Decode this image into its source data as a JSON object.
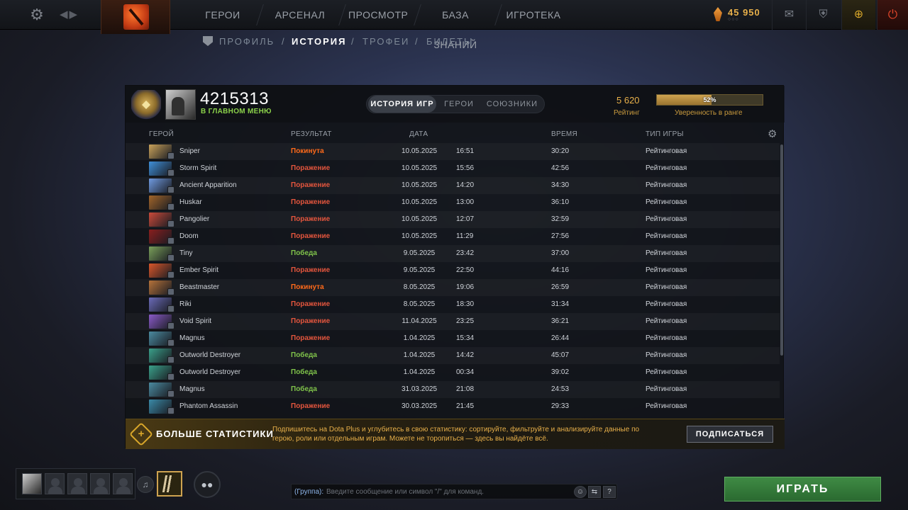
{
  "topbar": {
    "nav": [
      "ГЕРОИ",
      "АРСЕНАЛ",
      "ПРОСМОТР",
      "БАЗА ЗНАНИЙ",
      "ИГРОТЕКА"
    ],
    "currency_amount": "45 950",
    "icons": [
      "settings-gear-icon",
      "back-forward-arrows-icon",
      "dota-logo",
      "mail-icon",
      "armory-icon",
      "dota-plus-icon",
      "power-icon"
    ]
  },
  "subnav": {
    "items": [
      "ПРОФИЛЬ",
      "ИСТОРИЯ",
      "ТРОФЕИ",
      "БИЛЕТЫ"
    ],
    "active": "ИСТОРИЯ",
    "separator": "/"
  },
  "profile": {
    "player_id": "4215313",
    "status": "В ГЛАВНОМ МЕНЮ",
    "tabs": [
      "ИСТОРИЯ ИГР",
      "ГЕРОИ",
      "СОЮЗНИКИ"
    ],
    "rating_value": "5 620",
    "rating_label": "Рейтинг",
    "confidence_pct": "52%",
    "confidence_fraction": 0.52,
    "confidence_label": "Уверенность в ранге"
  },
  "table": {
    "headers": {
      "hero": "ГЕРОЙ",
      "result": "РЕЗУЛЬТАТ",
      "date": "ДАТА",
      "duration": "ВРЕМЯ",
      "mode": "ТИП ИГРЫ"
    },
    "rows": [
      {
        "hero": "Sniper",
        "result": "Покинута",
        "kind": "left",
        "date": "10.05.2025",
        "time": "16:51",
        "duration": "30:20",
        "mode": "Рейтинговая",
        "portrait": "#c9a25a"
      },
      {
        "hero": "Storm Spirit",
        "result": "Поражение",
        "kind": "loss",
        "date": "10.05.2025",
        "time": "15:56",
        "duration": "42:56",
        "mode": "Рейтинговая",
        "portrait": "#3f8fd8"
      },
      {
        "hero": "Ancient Apparition",
        "result": "Поражение",
        "kind": "loss",
        "date": "10.05.2025",
        "time": "14:20",
        "duration": "34:30",
        "mode": "Рейтинговая",
        "portrait": "#6f9ae0"
      },
      {
        "hero": "Huskar",
        "result": "Поражение",
        "kind": "loss",
        "date": "10.05.2025",
        "time": "13:00",
        "duration": "36:10",
        "mode": "Рейтинговая",
        "portrait": "#a2652a"
      },
      {
        "hero": "Pangolier",
        "result": "Поражение",
        "kind": "loss",
        "date": "10.05.2025",
        "time": "12:07",
        "duration": "32:59",
        "mode": "Рейтинговая",
        "portrait": "#c94a3a"
      },
      {
        "hero": "Doom",
        "result": "Поражение",
        "kind": "loss",
        "date": "10.05.2025",
        "time": "11:29",
        "duration": "27:56",
        "mode": "Рейтинговая",
        "portrait": "#8a1e1e"
      },
      {
        "hero": "Tiny",
        "result": "Победа",
        "kind": "win",
        "date": "9.05.2025",
        "time": "23:42",
        "duration": "37:00",
        "mode": "Рейтинговая",
        "portrait": "#7aa05a"
      },
      {
        "hero": "Ember Spirit",
        "result": "Поражение",
        "kind": "loss",
        "date": "9.05.2025",
        "time": "22:50",
        "duration": "44:16",
        "mode": "Рейтинговая",
        "portrait": "#d8562a"
      },
      {
        "hero": "Beastmaster",
        "result": "Покинута",
        "kind": "left",
        "date": "8.05.2025",
        "time": "19:06",
        "duration": "26:59",
        "mode": "Рейтинговая",
        "portrait": "#b5723a"
      },
      {
        "hero": "Riki",
        "result": "Поражение",
        "kind": "loss",
        "date": "8.05.2025",
        "time": "18:30",
        "duration": "31:34",
        "mode": "Рейтинговая",
        "portrait": "#6a6ab8"
      },
      {
        "hero": "Void Spirit",
        "result": "Поражение",
        "kind": "loss",
        "date": "11.04.2025",
        "time": "23:25",
        "duration": "36:21",
        "mode": "Рейтинговая",
        "portrait": "#8a5ac8"
      },
      {
        "hero": "Magnus",
        "result": "Поражение",
        "kind": "loss",
        "date": "1.04.2025",
        "time": "15:34",
        "duration": "26:44",
        "mode": "Рейтинговая",
        "portrait": "#4a8aa0"
      },
      {
        "hero": "Outworld Destroyer",
        "result": "Победа",
        "kind": "win",
        "date": "1.04.2025",
        "time": "14:42",
        "duration": "45:07",
        "mode": "Рейтинговая",
        "portrait": "#3aa08a"
      },
      {
        "hero": "Outworld Destroyer",
        "result": "Победа",
        "kind": "win",
        "date": "1.04.2025",
        "time": "00:34",
        "duration": "39:02",
        "mode": "Рейтинговая",
        "portrait": "#3aa08a"
      },
      {
        "hero": "Magnus",
        "result": "Победа",
        "kind": "win",
        "date": "31.03.2025",
        "time": "21:08",
        "duration": "24:53",
        "mode": "Рейтинговая",
        "portrait": "#4a8aa0"
      },
      {
        "hero": "Phantom Assassin",
        "result": "Поражение",
        "kind": "loss",
        "date": "30.03.2025",
        "time": "21:45",
        "duration": "29:33",
        "mode": "Рейтинговая",
        "portrait": "#3a8aa8"
      }
    ]
  },
  "plus_banner": {
    "title": "БОЛЬШЕ СТАТИСТИКИ",
    "text": "Подпишитесь на Dota Plus и углубитесь в свою статистику: сортируйте, фильтруйте и анализируйте данные по герою, роли или отдельным играм. Можете не торопиться — здесь вы найдёте всё.",
    "button": "ПОДПИСАТЬСЯ"
  },
  "chat": {
    "prefix": "(Группа):",
    "placeholder": "Введите сообщение или символ \"/\" для команд."
  },
  "play_button": "ИГРАТЬ"
}
